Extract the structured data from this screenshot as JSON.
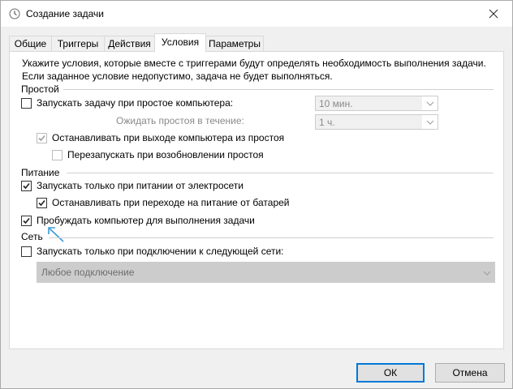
{
  "window": {
    "title": "Создание задачи"
  },
  "tabs": [
    {
      "label": "Общие"
    },
    {
      "label": "Триггеры"
    },
    {
      "label": "Действия"
    },
    {
      "label": "Условия",
      "active": true
    },
    {
      "label": "Параметры"
    }
  ],
  "description": {
    "line1": "Укажите условия, которые вместе с триггерами будут определять необходимость выполнения задачи.",
    "line2": "Если заданное условие недопустимо, задача не будет выполняться."
  },
  "idle": {
    "group_label": "Простой",
    "start_if_idle": {
      "label": "Запускать задачу при простое компьютера:",
      "checked": false
    },
    "idle_duration": {
      "value": "10 мин."
    },
    "wait_label": "Ожидать простоя в течение:",
    "wait_duration": {
      "value": "1 ч."
    },
    "stop_on_idle_end": {
      "label": "Останавливать при выходе компьютера из простоя",
      "checked": true,
      "disabled": true
    },
    "restart_on_idle_resume": {
      "label": "Перезапускать при возобновлении простоя",
      "checked": false,
      "disabled": true
    }
  },
  "power": {
    "group_label": "Питание",
    "ac_only": {
      "label": "Запускать только при питании от электросети",
      "checked": true
    },
    "stop_on_battery": {
      "label": "Останавливать при переходе на питание от батарей",
      "checked": true
    },
    "wake_to_run": {
      "label": "Пробуждать компьютер для выполнения задачи",
      "checked": true
    }
  },
  "network": {
    "group_label": "Сеть",
    "network_only": {
      "label": "Запускать только при подключении к следующей сети:",
      "checked": false
    },
    "connection": {
      "value": "Любое подключение"
    }
  },
  "buttons": {
    "ok": "ОК",
    "cancel": "Отмена"
  },
  "colors": {
    "accent": "#0078d7",
    "pointer_arrow": "#3a9ad9"
  }
}
